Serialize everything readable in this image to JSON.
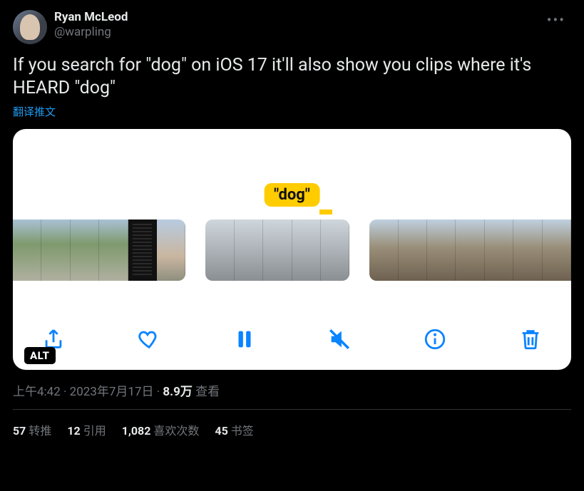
{
  "author": {
    "display_name": "Ryan McLeod",
    "handle": "@warpling"
  },
  "tweet_text": "If you search for \"dog\" on iOS 17 it'll also show you clips where it's HEARD \"dog\"",
  "translate_label": "翻译推文",
  "media": {
    "search_label": "\"dog\"",
    "alt_badge": "ALT",
    "toolbar": {
      "share": "share",
      "like": "like",
      "pause": "pause",
      "mute": "mute",
      "info": "info",
      "trash": "trash"
    }
  },
  "metadata": {
    "time": "上午4:42",
    "sep1": " · ",
    "date": "2023年7月17日",
    "sep2": " · ",
    "views_count": "8.9万",
    "views_label": " 查看"
  },
  "stats": {
    "retweets": {
      "count": "57",
      "label": "转推"
    },
    "quotes": {
      "count": "12",
      "label": "引用"
    },
    "likes": {
      "count": "1,082",
      "label": "喜欢次数"
    },
    "bookmarks": {
      "count": "45",
      "label": "书签"
    }
  }
}
